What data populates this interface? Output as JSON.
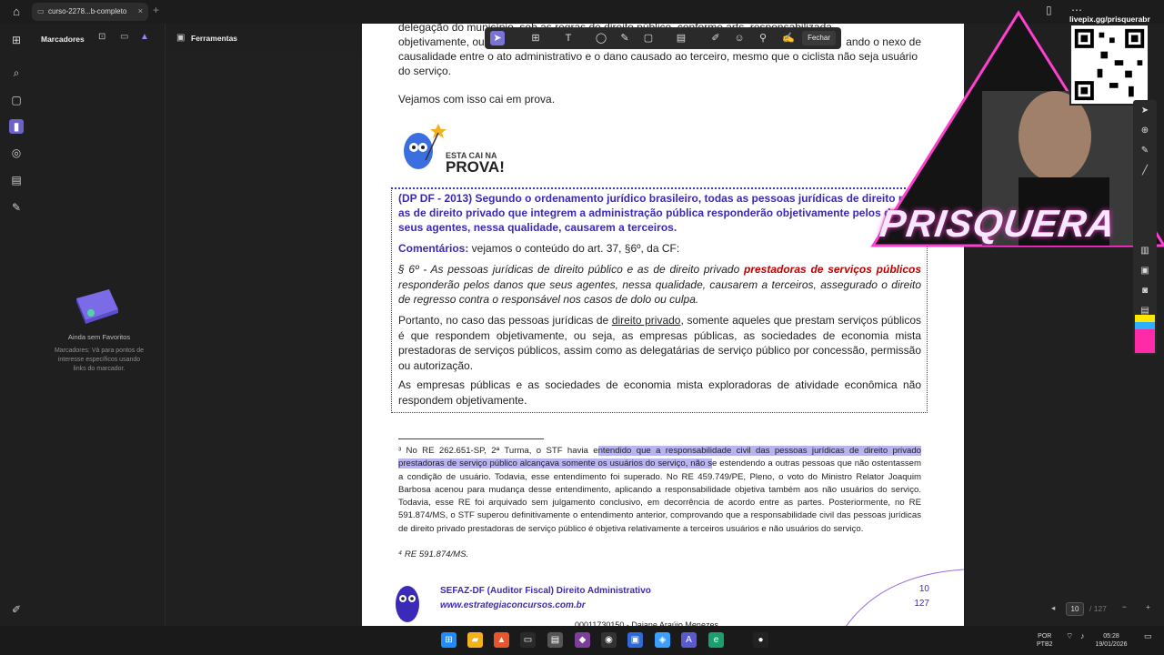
{
  "browser": {
    "tab_title": "curso-2278...b-completo",
    "close_glyph": "×",
    "new_tab_glyph": "+"
  },
  "sidebar": {
    "bookmarks_title": "Marcadores",
    "empty_title": "Ainda sem Favoritos",
    "empty_hint": "Marcadores: Vá para pontos de interesse específicos usando links do marcador."
  },
  "tools_panel": {
    "title": "Ferramentas"
  },
  "annotation_toolbar": {
    "close_label": "Fechar"
  },
  "document": {
    "top_line1": "delegação do município, sob as regras de direito público, conforme arts. responsabilizada",
    "top_line2a": "objetivamente, ou",
    "top_line2b": "ando o nexo de",
    "top_line3": "causalidade entre o ato administrativo e o dano causado ao terceiro, mesmo que o ciclista não seja usuário",
    "top_line4": "do serviço.",
    "intro": "Vejamos com isso cai em prova.",
    "badge_small": "ESTA CAI NA",
    "badge_big": "PROVA!",
    "question_1": "(DP DF - 2013) Segundo o ordenamento jurídico brasileiro, todas as pessoas jurídicas de direito púb",
    "question_2": "as de direito privado que integrem a administração pública responderão objetivamente pelos d",
    "question_3": "seus agentes, nessa qualidade, causarem a terceiros.",
    "comments_label": "Comentários:",
    "comments_text": " vejamos o conteúdo do art. 37, §6º, da CF:",
    "law_a": "§ 6º - As pessoas jurídicas de direito público e as de direito privado ",
    "law_red": "prestadoras de serviços públicos",
    "law_b": " responderão pelos danos que seus agentes, nessa qualidade, causarem a terceiros, assegurado o direito de regresso contra o responsável nos casos de dolo ou culpa.",
    "para1_a": "Portanto, no caso das pessoas jurídicas de ",
    "para1_u": "direito privado",
    "para1_b": ", somente aqueles que prestam serviços públicos é que respondem objetivamente, ou seja, as empresas públicas, as sociedades de economia mista prestadoras de serviços públicos, assim como as delegatárias de serviço público por concessão, permissão ou autorização.",
    "para2": "As empresas públicas e as sociedades de economia mista exploradoras de atividade econômica não respondem objetivamente.",
    "fn3_a": "³ No RE 262.651-SP, 2ª Turma, o STF havia e",
    "fn3_hl": "ntendido que a responsabilidade civil das pessoas jurídicas de direito privado prestadoras de serviço público alcançava somente os usuários do serviço, não s",
    "fn3_b": "e estendendo a outras pessoas que não ostentassem a condição de usuário. Todavia, esse entendimento foi superado. No RE 459.749/PE, Pleno, o voto do Ministro Relator Joaquim Barbosa acenou para mudança desse entendimento, aplicando a responsabilidade objetiva também aos não usuários do serviço. Todavia, esse RE foi arquivado sem julgamento conclusivo, em decorrência de acordo entre as partes. Posteriormente, no RE 591.874/MS, o STF superou definitivamente o entendimento anterior, comprovando que a responsabilidade civil das pessoas jurídicas de direito privado prestadoras de serviço público é objetiva relativamente a terceiros usuários e não usuários do serviço.",
    "fn4": "⁴ RE 591.874/MS.",
    "footer_title": "SEFAZ-DF (Auditor Fiscal) Direito Administrativo",
    "footer_url": "www.estrategiaconcursos.com.br",
    "footer_page": "10",
    "footer_total": "127",
    "footer_bottom": "00011730150 - Daiane Araújo Menezes"
  },
  "pager": {
    "current": "10",
    "total": "/ 127"
  },
  "overlay": {
    "qr_label": "livepix.gg/prisquerabr",
    "brand": "PRISQUERA"
  },
  "taskbar": {
    "lang1": "POR",
    "lang2": "PTB2",
    "time": "05:28",
    "date": "19/01/2026"
  },
  "colors": {
    "accent": "#6b63c6",
    "question_blue": "#3b2ab8",
    "law_red": "#c00000",
    "highlight": "#b9b4ee",
    "stream_pink": "#ff3fd0"
  }
}
